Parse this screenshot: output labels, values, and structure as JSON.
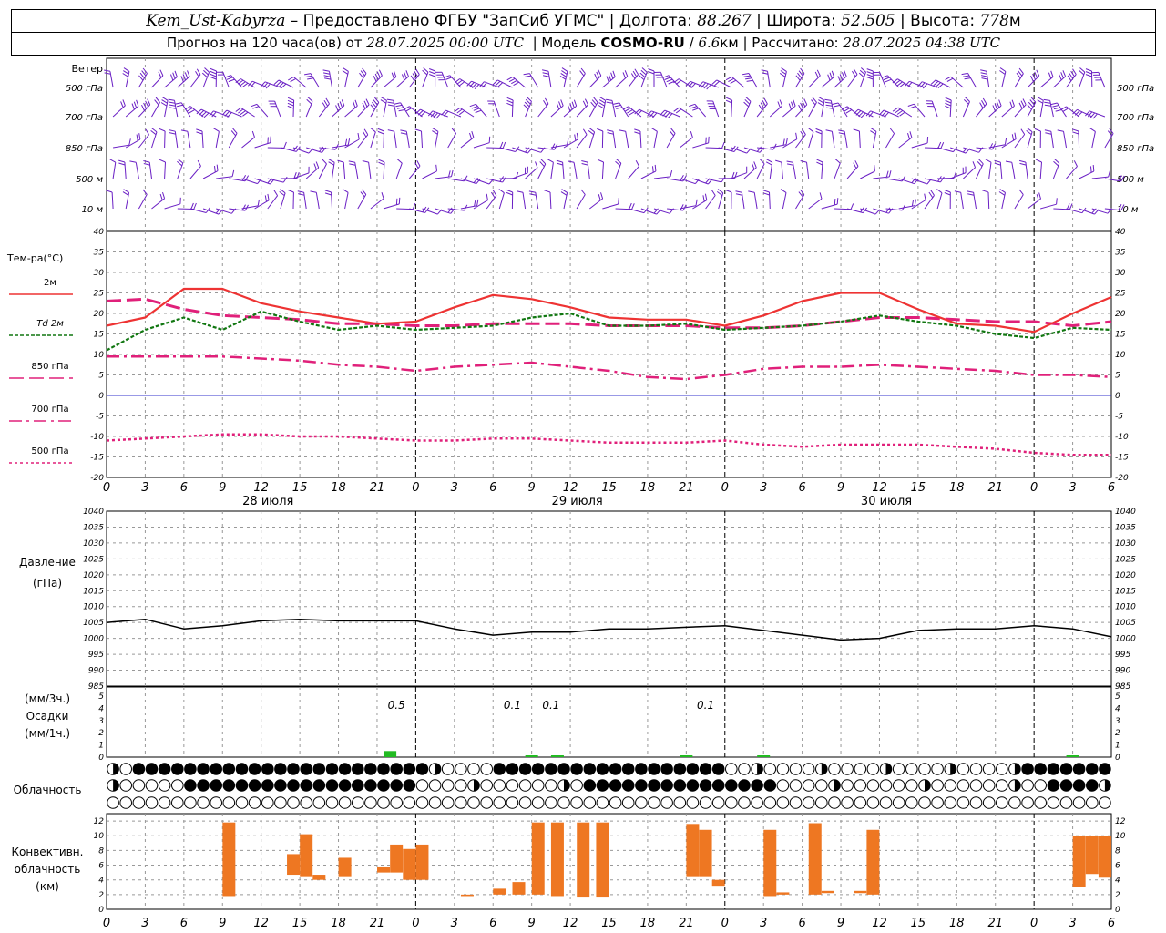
{
  "header": {
    "station": "Kem_Ust-Kabyrza",
    "sep": " – ",
    "provider": "Предоставлено ФГБУ \"ЗапСиб УГМС\"",
    "lon_label": "Долгота:",
    "lon": "88.267",
    "lat_label": "Широта:",
    "lat": "52.505",
    "alt_label": "Высота:",
    "alt": "778",
    "alt_unit": "м",
    "forecast_prefix": "Прогноз на 120 часа(ов) от",
    "forecast_from": "28.07.2025 00:00 UTC",
    "model_label": "Модель",
    "model": "COSMO-RU",
    "model_res": "6.6",
    "model_res_unit": "км",
    "calc_label": "Рассчитано:",
    "calc": "28.07.2025 04:38 UTC"
  },
  "labels": {
    "wind": "Ветер",
    "levels": [
      "500 гПа",
      "700 гПа",
      "850 гПа",
      "500 м",
      "10 м"
    ],
    "temp_title": "Тем-ра(°С)",
    "legend": [
      "2м",
      "Td  2м",
      "850 гПа",
      "700 гПа",
      "500 гПа"
    ],
    "pressure_title": "Давление",
    "pressure_unit": "(гПа)",
    "precip_unit3": "(мм/3ч.)",
    "precip_title": "Осадки",
    "precip_unit1": "(мм/1ч.)",
    "cloud_title": "Облачность",
    "conv_title": [
      "Конвективн.",
      "облачность",
      "(км)"
    ],
    "days": [
      "28 июля",
      "29 июля",
      "30 июля"
    ],
    "hour_ticks": [
      "0",
      "3",
      "6",
      "9",
      "12",
      "15",
      "18",
      "21",
      "0",
      "3",
      "6",
      "9",
      "12",
      "15",
      "18",
      "21",
      "0",
      "3",
      "6",
      "9",
      "12",
      "15",
      "18",
      "21",
      "0",
      "3",
      "6"
    ]
  },
  "colors": {
    "t2m": "#ee3333",
    "td2m": "#117711",
    "t850": "#e0207a",
    "t700": "#e0207a",
    "t500": "#e0207a",
    "zero_line": "#3333cc",
    "wind": "#6a1fc4",
    "precip": "#22bb22",
    "conv": "#ee7722",
    "pressure": "#000000"
  },
  "chart_data": [
    {
      "type": "line",
      "name": "temperature",
      "x_unit": "hours since 28.07.2025 00:00 UTC",
      "ylim": [
        -20,
        40
      ],
      "yticks": [
        -20,
        -15,
        -10,
        -5,
        0,
        5,
        10,
        15,
        20,
        25,
        30,
        35,
        40
      ],
      "x": [
        0,
        3,
        6,
        9,
        12,
        15,
        18,
        21,
        24,
        27,
        30,
        33,
        36,
        39,
        42,
        45,
        48,
        51,
        54,
        57,
        60,
        63,
        66,
        69,
        72,
        75,
        78
      ],
      "series": [
        {
          "name": "2м",
          "values": [
            17,
            19,
            26,
            26,
            22.5,
            20.5,
            19,
            17.5,
            18,
            21.5,
            24.5,
            23.5,
            21.5,
            19,
            18.5,
            18.5,
            17,
            19.5,
            23,
            25,
            25,
            21,
            17.5,
            17,
            15.5,
            20,
            24
          ]
        },
        {
          "name": "Td  2м",
          "values": [
            11,
            16,
            19,
            16,
            20.5,
            18,
            16,
            17,
            16,
            16.5,
            17,
            19,
            20,
            17,
            17,
            17.5,
            16,
            16.5,
            17,
            18,
            19.5,
            18,
            17,
            15,
            14,
            16.5,
            16
          ]
        },
        {
          "name": "850 гПа",
          "values": [
            23,
            23.5,
            21,
            19.5,
            19,
            18.5,
            17.5,
            17.5,
            17,
            17,
            17.5,
            17.5,
            17.5,
            17,
            17,
            17,
            16.5,
            16.5,
            17,
            18,
            19,
            19,
            18.5,
            18,
            18,
            17,
            18
          ]
        },
        {
          "name": "700 гПа",
          "values": [
            9.5,
            9.5,
            9.5,
            9.5,
            9,
            8.5,
            7.5,
            7,
            6,
            7,
            7.5,
            8,
            7,
            6,
            4.5,
            4,
            5,
            6.5,
            7,
            7,
            7.5,
            7,
            6.5,
            6,
            5,
            5,
            4.5
          ]
        },
        {
          "name": "500 гПа",
          "values": [
            -11,
            -10.5,
            -10,
            -9.5,
            -9.5,
            -10,
            -10,
            -10.5,
            -11,
            -11,
            -10.5,
            -10.5,
            -11,
            -11.5,
            -11.5,
            -11.5,
            -11,
            -12,
            -12.5,
            -12,
            -12,
            -12,
            -12.5,
            -13,
            -14,
            -14.5,
            -14.5
          ]
        }
      ]
    },
    {
      "type": "line",
      "name": "pressure",
      "x_unit": "hours since 28.07.2025 00:00 UTC",
      "ylim": [
        985,
        1040
      ],
      "yticks": [
        985,
        990,
        995,
        1000,
        1005,
        1010,
        1015,
        1020,
        1025,
        1030,
        1035,
        1040
      ],
      "x": [
        0,
        3,
        6,
        9,
        12,
        15,
        18,
        21,
        24,
        27,
        30,
        33,
        36,
        39,
        42,
        45,
        48,
        51,
        54,
        57,
        60,
        63,
        66,
        69,
        72,
        75,
        78
      ],
      "values": [
        1005,
        1006,
        1003,
        1004,
        1005.5,
        1006,
        1005.5,
        1005.5,
        1005.5,
        1003,
        1001,
        1002,
        1002,
        1003,
        1003,
        1003.5,
        1004,
        1002.5,
        1001,
        999.5,
        1000,
        1002.5,
        1003,
        1003,
        1004,
        1003,
        1000.5
      ]
    },
    {
      "type": "bar",
      "name": "precipitation",
      "ylim": [
        0,
        5
      ],
      "yticks": [
        0,
        1,
        2,
        3,
        4,
        5
      ],
      "bars": [
        {
          "x": 22,
          "value": 0.5
        },
        {
          "x": 33,
          "value": 0.1
        },
        {
          "x": 35,
          "value": 0.1
        },
        {
          "x": 45,
          "value": 0.1
        },
        {
          "x": 51,
          "value": 0.1
        },
        {
          "x": 75,
          "value": 0.1
        }
      ],
      "labels": [
        {
          "x": 22.5,
          "text": "0.5"
        },
        {
          "x": 31.5,
          "text": "0.1"
        },
        {
          "x": 34.5,
          "text": "0.1"
        },
        {
          "x": 46.5,
          "text": "0.1"
        }
      ]
    },
    {
      "type": "bar",
      "name": "convective cloud",
      "ylim": [
        0,
        13
      ],
      "yticks": [
        0,
        2,
        4,
        6,
        8,
        10,
        12
      ],
      "bars": [
        {
          "x": 9.5,
          "bottom": 1.8,
          "top": 11.8
        },
        {
          "x": 14.5,
          "bottom": 4.7,
          "top": 7.5
        },
        {
          "x": 15.5,
          "bottom": 4.5,
          "top": 10.2
        },
        {
          "x": 16.5,
          "bottom": 4.0,
          "top": 4.7
        },
        {
          "x": 18.5,
          "bottom": 4.5,
          "top": 7.0
        },
        {
          "x": 21.5,
          "bottom": 5.0,
          "top": 5.7
        },
        {
          "x": 22.5,
          "bottom": 5.0,
          "top": 8.8
        },
        {
          "x": 23.5,
          "bottom": 4.0,
          "top": 8.2
        },
        {
          "x": 24.5,
          "bottom": 4.0,
          "top": 8.8
        },
        {
          "x": 28,
          "bottom": 1.8,
          "top": 2.0
        },
        {
          "x": 30.5,
          "bottom": 2.0,
          "top": 2.8
        },
        {
          "x": 32,
          "bottom": 2.0,
          "top": 3.7
        },
        {
          "x": 33.5,
          "bottom": 2.0,
          "top": 11.8
        },
        {
          "x": 35,
          "bottom": 1.8,
          "top": 11.8
        },
        {
          "x": 37,
          "bottom": 1.6,
          "top": 11.8
        },
        {
          "x": 38.5,
          "bottom": 1.6,
          "top": 11.8
        },
        {
          "x": 45.5,
          "bottom": 4.5,
          "top": 11.6
        },
        {
          "x": 46.5,
          "bottom": 4.5,
          "top": 10.8
        },
        {
          "x": 47.5,
          "bottom": 3.2,
          "top": 4.0
        },
        {
          "x": 51.5,
          "bottom": 1.8,
          "top": 10.8
        },
        {
          "x": 52.5,
          "bottom": 2.0,
          "top": 2.3
        },
        {
          "x": 55,
          "bottom": 2.0,
          "top": 11.7
        },
        {
          "x": 56,
          "bottom": 2.2,
          "top": 2.5
        },
        {
          "x": 58.5,
          "bottom": 2.2,
          "top": 2.5
        },
        {
          "x": 59.5,
          "bottom": 2.0,
          "top": 10.8
        },
        {
          "x": 75.5,
          "bottom": 3.0,
          "top": 10.0
        },
        {
          "x": 76.5,
          "bottom": 4.8,
          "top": 10.0
        },
        {
          "x": 77.5,
          "bottom": 4.3,
          "top": 10.0
        }
      ]
    }
  ]
}
